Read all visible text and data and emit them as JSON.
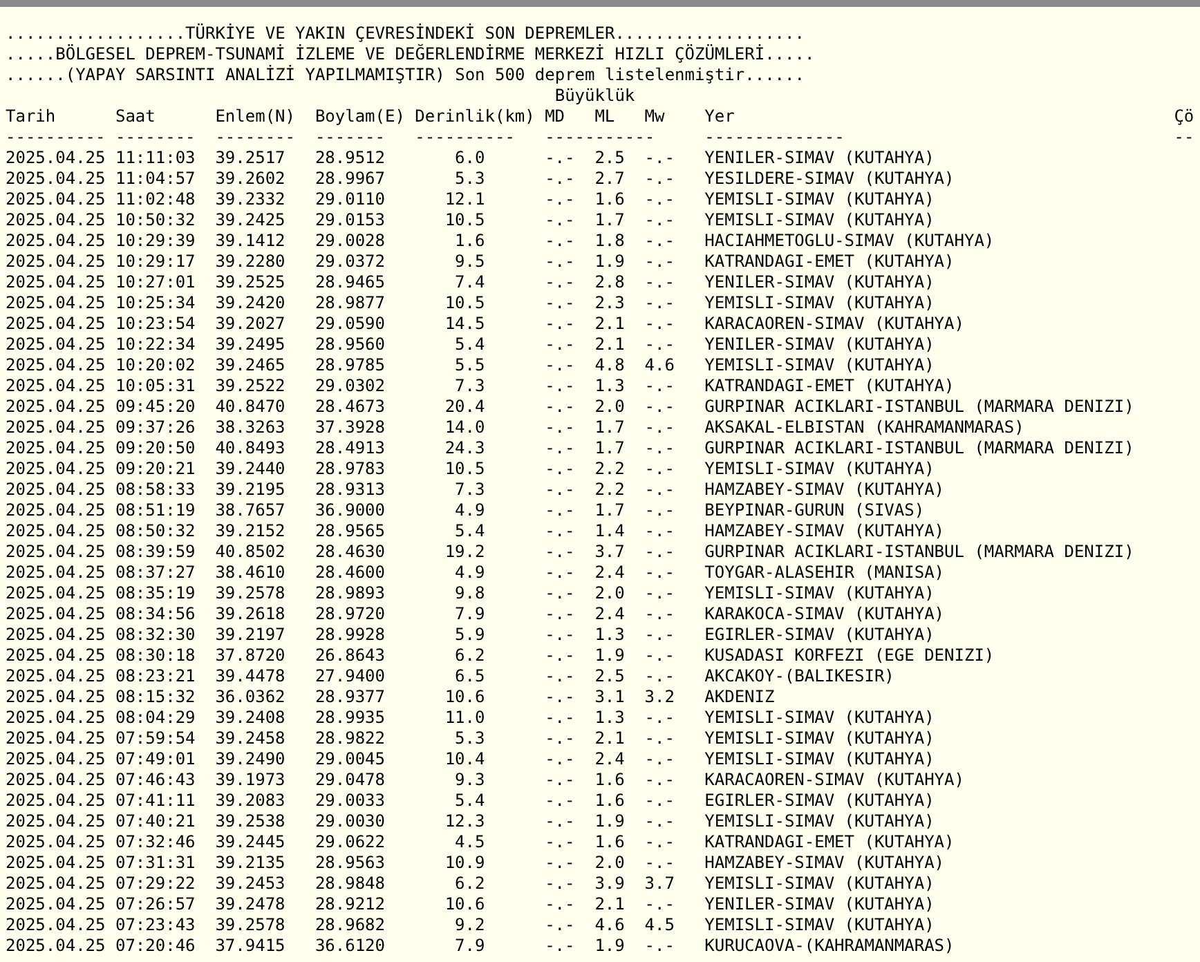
{
  "title_lines": [
    "..................TÜRKİYE VE YAKIN ÇEVRESİNDEKİ SON DEPREMLER...................",
    ".....BÖLGESEL DEPREM-TSUNAMİ İZLEME VE DEĞERLENDİRME MERKEZİ HIZLI ÇÖZÜMLERİ.....",
    "......(YAPAY SARSINTI ANALİZİ YAPILMAMIŞTIR) Son 500 deprem listelenmiştir......"
  ],
  "magnitude_group": "Büyüklük",
  "columns": [
    "Tarih",
    "Saat",
    "Enlem(N)",
    "Boylam(E)",
    "Derinlik(km)",
    "MD",
    "ML",
    "Mw",
    "Yer",
    "Çö"
  ],
  "separators": [
    "----------",
    "--------",
    "--------",
    "-------",
    "----------",
    "-----------",
    "--------------",
    "--"
  ],
  "rows": [
    {
      "date": "2025.04.25",
      "time": "11:11:03",
      "lat": "39.2517",
      "lon": "28.9512",
      "depth": "6.0",
      "md": "-.-",
      "ml": "2.5",
      "mw": "-.-",
      "place": "YENILER-SIMAV (KUTAHYA)"
    },
    {
      "date": "2025.04.25",
      "time": "11:04:57",
      "lat": "39.2602",
      "lon": "28.9967",
      "depth": "5.3",
      "md": "-.-",
      "ml": "2.7",
      "mw": "-.-",
      "place": "YESILDERE-SIMAV (KUTAHYA)"
    },
    {
      "date": "2025.04.25",
      "time": "11:02:48",
      "lat": "39.2332",
      "lon": "29.0110",
      "depth": "12.1",
      "md": "-.-",
      "ml": "1.6",
      "mw": "-.-",
      "place": "YEMISLI-SIMAV (KUTAHYA)"
    },
    {
      "date": "2025.04.25",
      "time": "10:50:32",
      "lat": "39.2425",
      "lon": "29.0153",
      "depth": "10.5",
      "md": "-.-",
      "ml": "1.7",
      "mw": "-.-",
      "place": "YEMISLI-SIMAV (KUTAHYA)"
    },
    {
      "date": "2025.04.25",
      "time": "10:29:39",
      "lat": "39.1412",
      "lon": "29.0028",
      "depth": "1.6",
      "md": "-.-",
      "ml": "1.8",
      "mw": "-.-",
      "place": "HACIAHMETOGLU-SIMAV (KUTAHYA)"
    },
    {
      "date": "2025.04.25",
      "time": "10:29:17",
      "lat": "39.2280",
      "lon": "29.0372",
      "depth": "9.5",
      "md": "-.-",
      "ml": "1.9",
      "mw": "-.-",
      "place": "KATRANDAGI-EMET (KUTAHYA)"
    },
    {
      "date": "2025.04.25",
      "time": "10:27:01",
      "lat": "39.2525",
      "lon": "28.9465",
      "depth": "7.4",
      "md": "-.-",
      "ml": "2.8",
      "mw": "-.-",
      "place": "YENILER-SIMAV (KUTAHYA)"
    },
    {
      "date": "2025.04.25",
      "time": "10:25:34",
      "lat": "39.2420",
      "lon": "28.9877",
      "depth": "10.5",
      "md": "-.-",
      "ml": "2.3",
      "mw": "-.-",
      "place": "YEMISLI-SIMAV (KUTAHYA)"
    },
    {
      "date": "2025.04.25",
      "time": "10:23:54",
      "lat": "39.2027",
      "lon": "29.0590",
      "depth": "14.5",
      "md": "-.-",
      "ml": "2.1",
      "mw": "-.-",
      "place": "KARACAOREN-SIMAV (KUTAHYA)"
    },
    {
      "date": "2025.04.25",
      "time": "10:22:34",
      "lat": "39.2495",
      "lon": "28.9560",
      "depth": "5.4",
      "md": "-.-",
      "ml": "2.1",
      "mw": "-.-",
      "place": "YENILER-SIMAV (KUTAHYA)"
    },
    {
      "date": "2025.04.25",
      "time": "10:20:02",
      "lat": "39.2465",
      "lon": "28.9785",
      "depth": "5.5",
      "md": "-.-",
      "ml": "4.8",
      "mw": "4.6",
      "place": "YEMISLI-SIMAV (KUTAHYA)"
    },
    {
      "date": "2025.04.25",
      "time": "10:05:31",
      "lat": "39.2522",
      "lon": "29.0302",
      "depth": "7.3",
      "md": "-.-",
      "ml": "1.3",
      "mw": "-.-",
      "place": "KATRANDAGI-EMET (KUTAHYA)"
    },
    {
      "date": "2025.04.25",
      "time": "09:45:20",
      "lat": "40.8470",
      "lon": "28.4673",
      "depth": "20.4",
      "md": "-.-",
      "ml": "2.0",
      "mw": "-.-",
      "place": "GURPINAR ACIKLARI-ISTANBUL (MARMARA DENIZI)"
    },
    {
      "date": "2025.04.25",
      "time": "09:37:26",
      "lat": "38.3263",
      "lon": "37.3928",
      "depth": "14.0",
      "md": "-.-",
      "ml": "1.7",
      "mw": "-.-",
      "place": "AKSAKAL-ELBISTAN (KAHRAMANMARAS)"
    },
    {
      "date": "2025.04.25",
      "time": "09:20:50",
      "lat": "40.8493",
      "lon": "28.4913",
      "depth": "24.3",
      "md": "-.-",
      "ml": "1.7",
      "mw": "-.-",
      "place": "GURPINAR ACIKLARI-ISTANBUL (MARMARA DENIZI)"
    },
    {
      "date": "2025.04.25",
      "time": "09:20:21",
      "lat": "39.2440",
      "lon": "28.9783",
      "depth": "10.5",
      "md": "-.-",
      "ml": "2.2",
      "mw": "-.-",
      "place": "YEMISLI-SIMAV (KUTAHYA)"
    },
    {
      "date": "2025.04.25",
      "time": "08:58:33",
      "lat": "39.2195",
      "lon": "28.9313",
      "depth": "7.3",
      "md": "-.-",
      "ml": "2.2",
      "mw": "-.-",
      "place": "HAMZABEY-SIMAV (KUTAHYA)"
    },
    {
      "date": "2025.04.25",
      "time": "08:51:19",
      "lat": "38.7657",
      "lon": "36.9000",
      "depth": "4.9",
      "md": "-.-",
      "ml": "1.7",
      "mw": "-.-",
      "place": "BEYPINAR-GURUN (SIVAS)"
    },
    {
      "date": "2025.04.25",
      "time": "08:50:32",
      "lat": "39.2152",
      "lon": "28.9565",
      "depth": "5.4",
      "md": "-.-",
      "ml": "1.4",
      "mw": "-.-",
      "place": "HAMZABEY-SIMAV (KUTAHYA)"
    },
    {
      "date": "2025.04.25",
      "time": "08:39:59",
      "lat": "40.8502",
      "lon": "28.4630",
      "depth": "19.2",
      "md": "-.-",
      "ml": "3.7",
      "mw": "-.-",
      "place": "GURPINAR ACIKLARI-ISTANBUL (MARMARA DENIZI)"
    },
    {
      "date": "2025.04.25",
      "time": "08:37:27",
      "lat": "38.4610",
      "lon": "28.4600",
      "depth": "4.9",
      "md": "-.-",
      "ml": "2.4",
      "mw": "-.-",
      "place": "TOYGAR-ALASEHIR (MANISA)"
    },
    {
      "date": "2025.04.25",
      "time": "08:35:19",
      "lat": "39.2578",
      "lon": "28.9893",
      "depth": "9.8",
      "md": "-.-",
      "ml": "2.0",
      "mw": "-.-",
      "place": "YEMISLI-SIMAV (KUTAHYA)"
    },
    {
      "date": "2025.04.25",
      "time": "08:34:56",
      "lat": "39.2618",
      "lon": "28.9720",
      "depth": "7.9",
      "md": "-.-",
      "ml": "2.4",
      "mw": "-.-",
      "place": "KARAKOCA-SIMAV (KUTAHYA)"
    },
    {
      "date": "2025.04.25",
      "time": "08:32:30",
      "lat": "39.2197",
      "lon": "28.9928",
      "depth": "5.9",
      "md": "-.-",
      "ml": "1.3",
      "mw": "-.-",
      "place": "EGIRLER-SIMAV (KUTAHYA)"
    },
    {
      "date": "2025.04.25",
      "time": "08:30:18",
      "lat": "37.8720",
      "lon": "26.8643",
      "depth": "6.2",
      "md": "-.-",
      "ml": "1.9",
      "mw": "-.-",
      "place": "KUSADASI KORFEZI (EGE DENIZI)"
    },
    {
      "date": "2025.04.25",
      "time": "08:23:21",
      "lat": "39.4478",
      "lon": "27.9400",
      "depth": "6.5",
      "md": "-.-",
      "ml": "2.5",
      "mw": "-.-",
      "place": "AKCAKOY-(BALIKESIR)"
    },
    {
      "date": "2025.04.25",
      "time": "08:15:32",
      "lat": "36.0362",
      "lon": "28.9377",
      "depth": "10.6",
      "md": "-.-",
      "ml": "3.1",
      "mw": "3.2",
      "place": "AKDENIZ"
    },
    {
      "date": "2025.04.25",
      "time": "08:04:29",
      "lat": "39.2408",
      "lon": "28.9935",
      "depth": "11.0",
      "md": "-.-",
      "ml": "1.3",
      "mw": "-.-",
      "place": "YEMISLI-SIMAV (KUTAHYA)"
    },
    {
      "date": "2025.04.25",
      "time": "07:59:54",
      "lat": "39.2458",
      "lon": "28.9822",
      "depth": "5.3",
      "md": "-.-",
      "ml": "2.1",
      "mw": "-.-",
      "place": "YEMISLI-SIMAV (KUTAHYA)"
    },
    {
      "date": "2025.04.25",
      "time": "07:49:01",
      "lat": "39.2490",
      "lon": "29.0045",
      "depth": "10.4",
      "md": "-.-",
      "ml": "2.4",
      "mw": "-.-",
      "place": "YEMISLI-SIMAV (KUTAHYA)"
    },
    {
      "date": "2025.04.25",
      "time": "07:46:43",
      "lat": "39.1973",
      "lon": "29.0478",
      "depth": "9.3",
      "md": "-.-",
      "ml": "1.6",
      "mw": "-.-",
      "place": "KARACAOREN-SIMAV (KUTAHYA)"
    },
    {
      "date": "2025.04.25",
      "time": "07:41:11",
      "lat": "39.2083",
      "lon": "29.0033",
      "depth": "5.4",
      "md": "-.-",
      "ml": "1.6",
      "mw": "-.-",
      "place": "EGIRLER-SIMAV (KUTAHYA)"
    },
    {
      "date": "2025.04.25",
      "time": "07:40:21",
      "lat": "39.2538",
      "lon": "29.0030",
      "depth": "12.3",
      "md": "-.-",
      "ml": "1.9",
      "mw": "-.-",
      "place": "YEMISLI-SIMAV (KUTAHYA)"
    },
    {
      "date": "2025.04.25",
      "time": "07:32:46",
      "lat": "39.2445",
      "lon": "29.0622",
      "depth": "4.5",
      "md": "-.-",
      "ml": "1.6",
      "mw": "-.-",
      "place": "KATRANDAGI-EMET (KUTAHYA)"
    },
    {
      "date": "2025.04.25",
      "time": "07:31:31",
      "lat": "39.2135",
      "lon": "28.9563",
      "depth": "10.9",
      "md": "-.-",
      "ml": "2.0",
      "mw": "-.-",
      "place": "HAMZABEY-SIMAV (KUTAHYA)"
    },
    {
      "date": "2025.04.25",
      "time": "07:29:22",
      "lat": "39.2453",
      "lon": "28.9848",
      "depth": "6.2",
      "md": "-.-",
      "ml": "3.9",
      "mw": "3.7",
      "place": "YEMISLI-SIMAV (KUTAHYA)"
    },
    {
      "date": "2025.04.25",
      "time": "07:26:57",
      "lat": "39.2478",
      "lon": "28.9212",
      "depth": "10.6",
      "md": "-.-",
      "ml": "2.1",
      "mw": "-.-",
      "place": "YENILER-SIMAV (KUTAHYA)"
    },
    {
      "date": "2025.04.25",
      "time": "07:23:43",
      "lat": "39.2578",
      "lon": "28.9682",
      "depth": "9.2",
      "md": "-.-",
      "ml": "4.6",
      "mw": "4.5",
      "place": "YEMISLI-SIMAV (KUTAHYA)"
    },
    {
      "date": "2025.04.25",
      "time": "07:20:46",
      "lat": "37.9415",
      "lon": "36.6120",
      "depth": "7.9",
      "md": "-.-",
      "ml": "1.9",
      "mw": "-.-",
      "place": "KURUCAOVA-(KAHRAMANMARAS)"
    }
  ]
}
